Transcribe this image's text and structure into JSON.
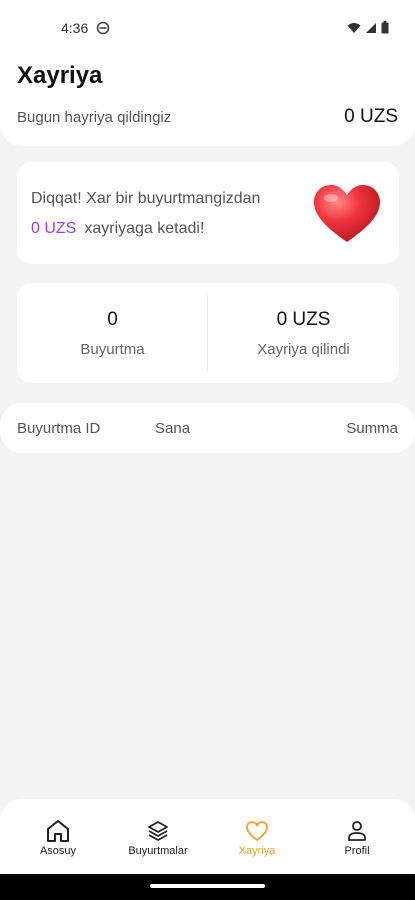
{
  "status_bar": {
    "time": "4:36"
  },
  "header": {
    "title": "Xayriya",
    "today_label": "Bugun hayriya qildingiz",
    "today_value": "0 UZS"
  },
  "notice": {
    "line1": "Diqqat! Xar bir buyurtmangizdan",
    "amount": "0 UZS",
    "line2_rest": "xayriyaga ketadi!",
    "accent_color": "#9b3ff0",
    "icon": "heart-icon"
  },
  "stats": {
    "orders_value": "0",
    "orders_label": "Buyurtma",
    "donated_value": "0 UZS",
    "donated_label": "Xayriya qilindi"
  },
  "table": {
    "columns": [
      "Buyurtma ID",
      "Sana",
      "Summa"
    ]
  },
  "bottom_nav": {
    "items": [
      {
        "label": "Asosuy",
        "icon": "home-icon"
      },
      {
        "label": "Buyurtmalar",
        "icon": "layers-icon"
      },
      {
        "label": "Xayriya",
        "icon": "heart-outline-icon",
        "active": true
      },
      {
        "label": "Profil",
        "icon": "user-icon"
      }
    ],
    "active_color": "#f4a12a"
  }
}
